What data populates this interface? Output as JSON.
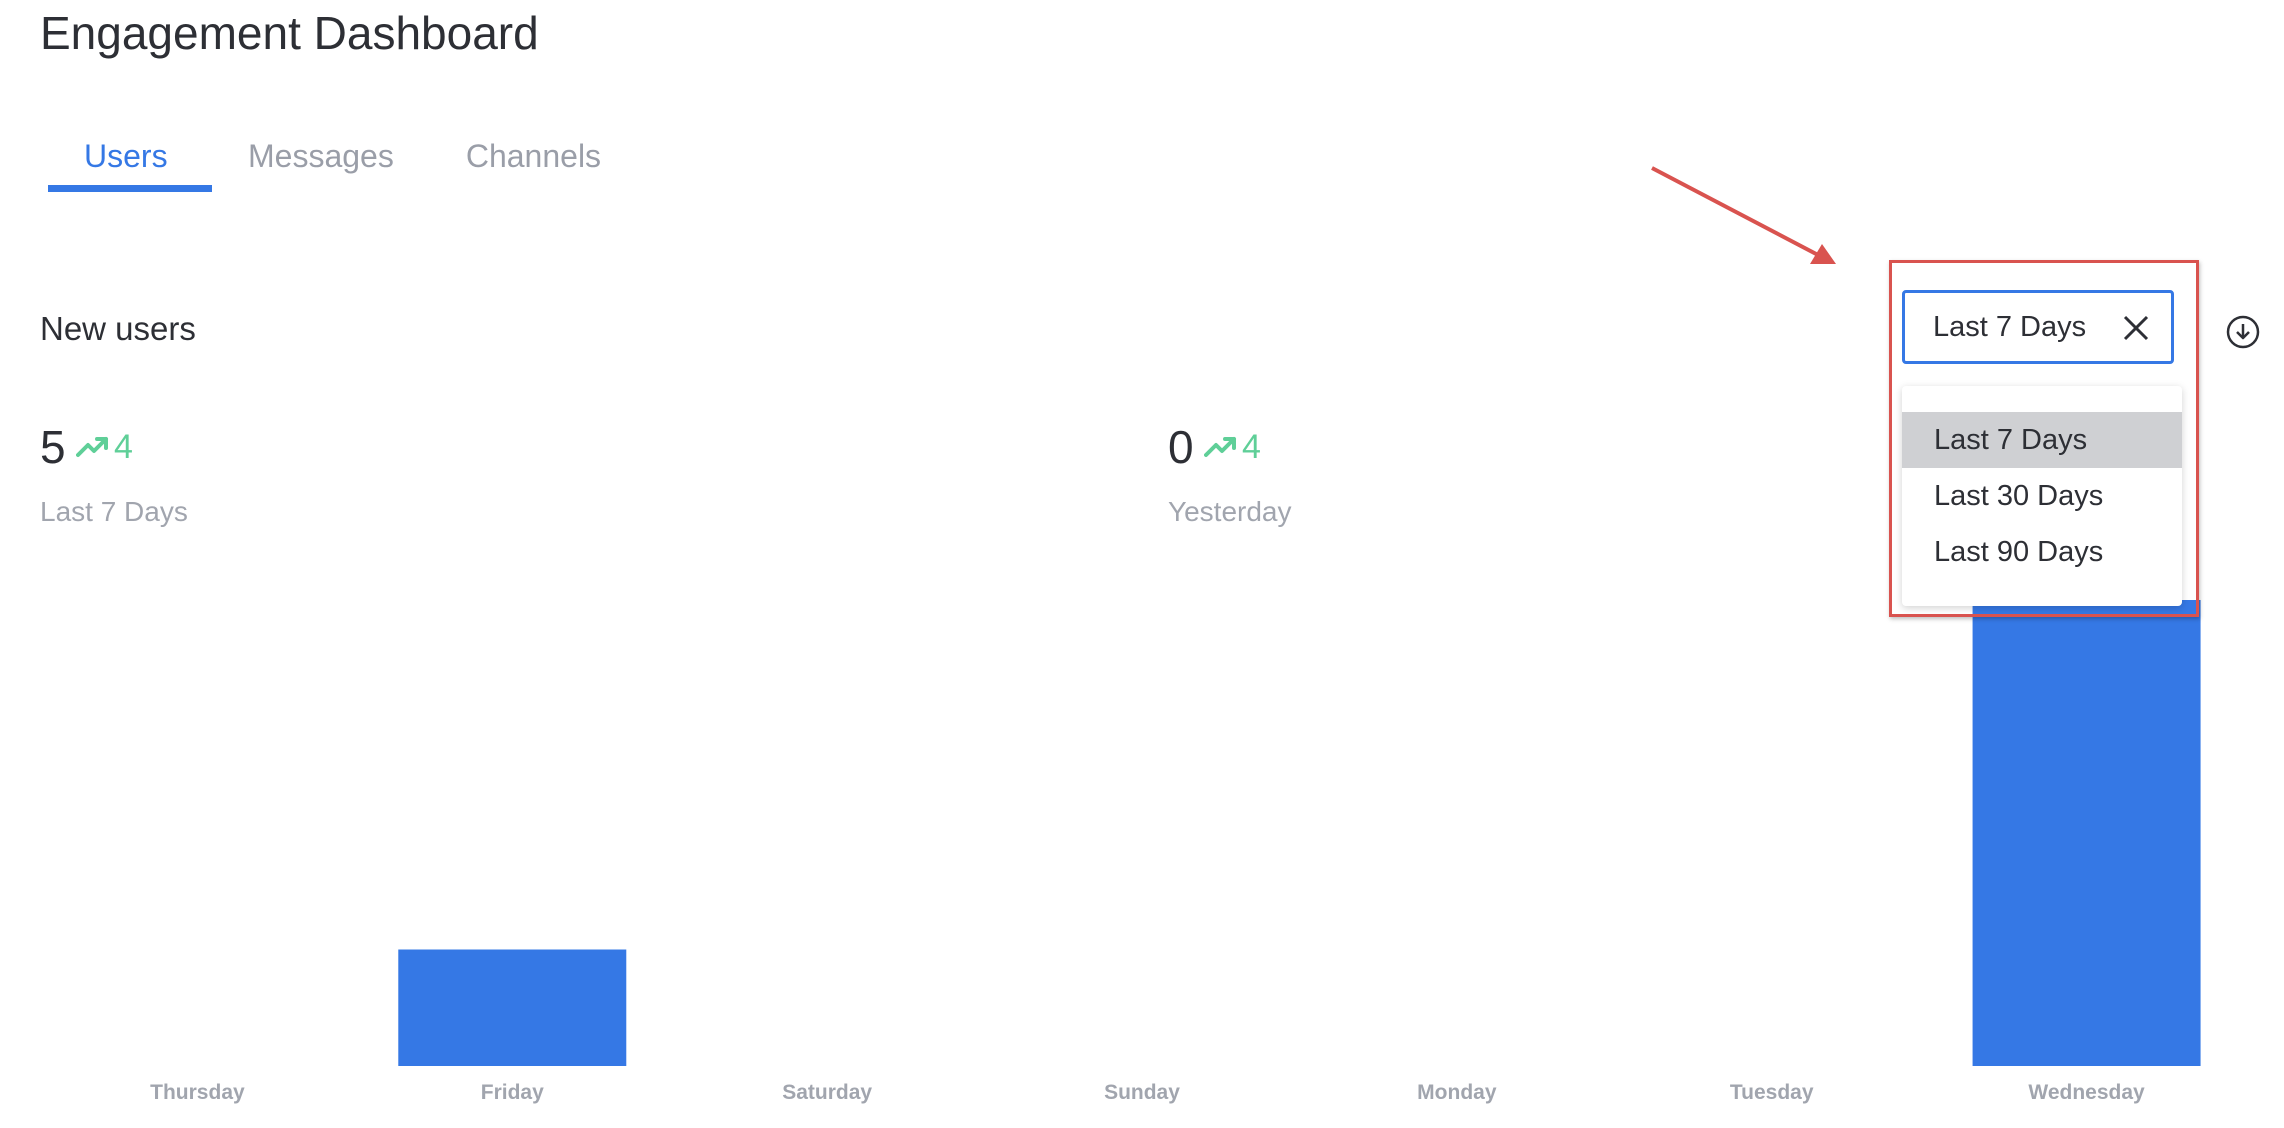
{
  "header": {
    "title": "Engagement Dashboard"
  },
  "tabs": [
    {
      "label": "Users",
      "active": true
    },
    {
      "label": "Messages",
      "active": false
    },
    {
      "label": "Channels",
      "active": false
    }
  ],
  "section": {
    "title": "New users"
  },
  "stats": [
    {
      "value": "5",
      "trend": "4",
      "label": "Last 7 Days"
    },
    {
      "value": "0",
      "trend": "4",
      "label": "Yesterday"
    }
  ],
  "period_select": {
    "value": "Last 7 Days",
    "options": [
      "Last 7 Days",
      "Last 30 Days",
      "Last 90 Days"
    ],
    "selected_index": 0
  },
  "icons": {
    "download": "download-icon",
    "clear": "close-icon",
    "trend": "trending-up-icon"
  },
  "colors": {
    "accent": "#3578e5",
    "trend": "#5fcf98",
    "annotation": "#d9534f"
  },
  "chart_data": {
    "type": "bar",
    "categories": [
      "Thursday",
      "Friday",
      "Saturday",
      "Sunday",
      "Monday",
      "Tuesday",
      "Wednesday"
    ],
    "values": [
      0,
      1,
      0,
      0,
      0,
      0,
      4
    ],
    "ylim": [
      0,
      4
    ],
    "grid": false
  }
}
